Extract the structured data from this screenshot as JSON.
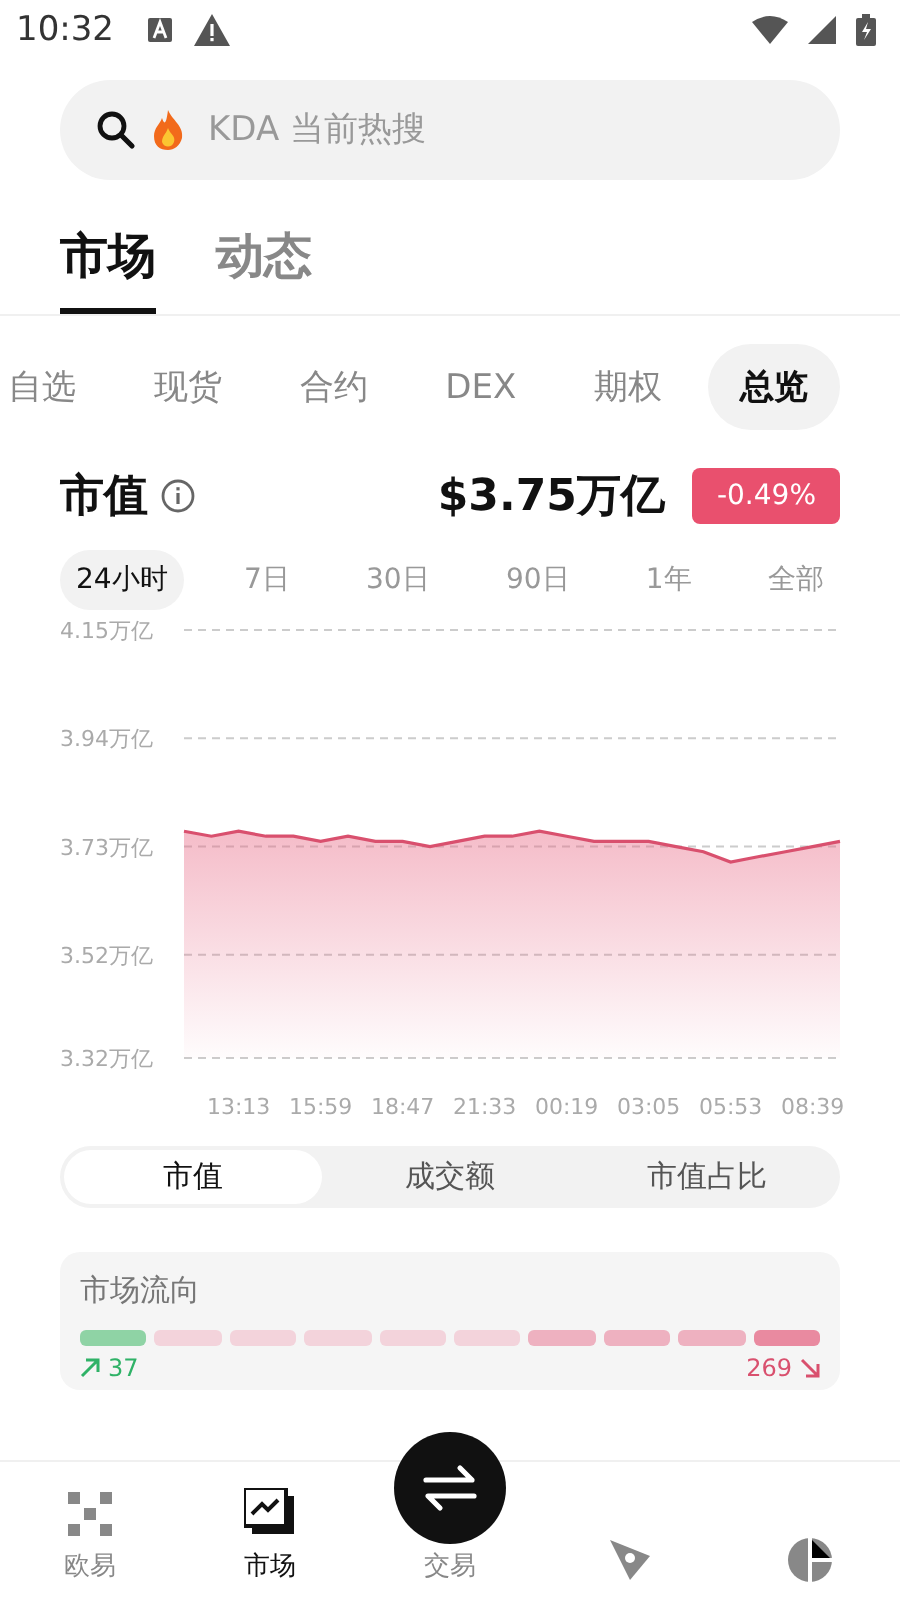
{
  "status_bar": {
    "time": "10:32"
  },
  "search": {
    "placeholder": "KDA 当前热搜"
  },
  "main_tabs": [
    {
      "label": "市场",
      "selected": true
    },
    {
      "label": "动态",
      "selected": false
    }
  ],
  "sub_tabs": [
    {
      "label": "自选",
      "selected": false
    },
    {
      "label": "现货",
      "selected": false
    },
    {
      "label": "合约",
      "selected": false
    },
    {
      "label": "DEX",
      "selected": false
    },
    {
      "label": "期权",
      "selected": false
    },
    {
      "label": "总览",
      "selected": true
    }
  ],
  "market_cap": {
    "title": "市值",
    "value": "$3.75万亿",
    "change": "-0.49%"
  },
  "ranges": [
    {
      "label": "24小时",
      "selected": true
    },
    {
      "label": "7日",
      "selected": false
    },
    {
      "label": "30日",
      "selected": false
    },
    {
      "label": "90日",
      "selected": false
    },
    {
      "label": "1年",
      "selected": false
    },
    {
      "label": "全部",
      "selected": false
    }
  ],
  "chart_data": {
    "type": "area",
    "grid": true,
    "categories": [
      null,
      null,
      "13:13",
      null,
      null,
      "15:59",
      null,
      null,
      "18:47",
      null,
      null,
      "21:33",
      null,
      null,
      "00:19",
      null,
      null,
      "03:05",
      null,
      null,
      "05:53",
      null,
      null,
      "08:39",
      null
    ],
    "series": [
      {
        "color": "#d9506e",
        "values": [
          3.76,
          3.75,
          3.76,
          3.75,
          3.75,
          3.74,
          3.75,
          3.74,
          3.74,
          3.73,
          3.74,
          3.75,
          3.75,
          3.76,
          3.75,
          3.74,
          3.74,
          3.74,
          3.73,
          3.72,
          3.7,
          3.71,
          3.72,
          3.73,
          3.74
        ]
      }
    ],
    "ylim": [
      3.32,
      4.15
    ],
    "yticks": [
      {
        "value": 4.15,
        "label": "4.15万亿"
      },
      {
        "value": 3.94,
        "label": "3.94万亿"
      },
      {
        "value": 3.73,
        "label": "3.73万亿"
      },
      {
        "value": 3.52,
        "label": "3.52万亿"
      },
      {
        "value": 3.32,
        "label": "3.32万亿"
      }
    ]
  },
  "metric_tabs": [
    {
      "label": "市值",
      "selected": true
    },
    {
      "label": "成交额",
      "selected": false
    },
    {
      "label": "市值占比",
      "selected": false
    }
  ],
  "market_flow": {
    "title": "市场流向",
    "segments": [
      {
        "color": "#8fd3a5"
      },
      {
        "color": "#f3d3db"
      },
      {
        "color": "#f3d3db"
      },
      {
        "color": "#f3d3db"
      },
      {
        "color": "#f3d3db"
      },
      {
        "color": "#f3d3db"
      },
      {
        "color": "#eeb1c0"
      },
      {
        "color": "#eeb1c0"
      },
      {
        "color": "#eeb1c0"
      },
      {
        "color": "#e98aa0"
      }
    ],
    "up": "37",
    "down": "269"
  },
  "bottom_nav": [
    {
      "kind": "grid",
      "label": "欧易",
      "selected": false
    },
    {
      "kind": "chart",
      "label": "市场",
      "selected": true
    },
    {
      "kind": "trade",
      "label": "交易",
      "selected": false
    },
    {
      "kind": "compass",
      "selected": false
    },
    {
      "kind": "pie",
      "selected": false
    }
  ]
}
